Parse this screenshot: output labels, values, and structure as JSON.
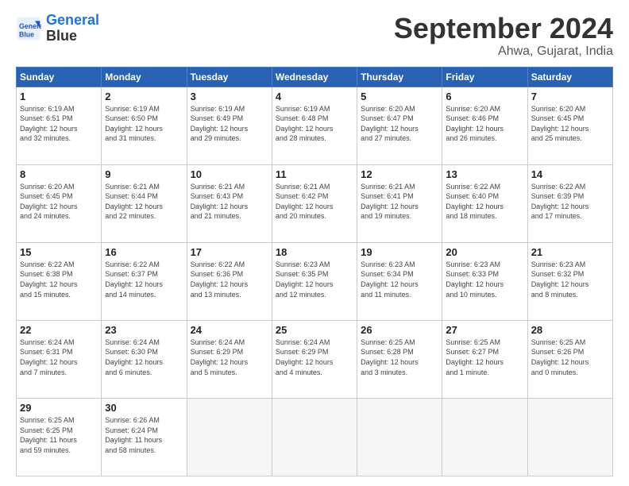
{
  "header": {
    "logo_line1": "General",
    "logo_line2": "Blue",
    "month": "September 2024",
    "location": "Ahwa, Gujarat, India"
  },
  "weekdays": [
    "Sunday",
    "Monday",
    "Tuesday",
    "Wednesday",
    "Thursday",
    "Friday",
    "Saturday"
  ],
  "weeks": [
    [
      {
        "day": "1",
        "info": "Sunrise: 6:19 AM\nSunset: 6:51 PM\nDaylight: 12 hours\nand 32 minutes."
      },
      {
        "day": "2",
        "info": "Sunrise: 6:19 AM\nSunset: 6:50 PM\nDaylight: 12 hours\nand 31 minutes."
      },
      {
        "day": "3",
        "info": "Sunrise: 6:19 AM\nSunset: 6:49 PM\nDaylight: 12 hours\nand 29 minutes."
      },
      {
        "day": "4",
        "info": "Sunrise: 6:19 AM\nSunset: 6:48 PM\nDaylight: 12 hours\nand 28 minutes."
      },
      {
        "day": "5",
        "info": "Sunrise: 6:20 AM\nSunset: 6:47 PM\nDaylight: 12 hours\nand 27 minutes."
      },
      {
        "day": "6",
        "info": "Sunrise: 6:20 AM\nSunset: 6:46 PM\nDaylight: 12 hours\nand 26 minutes."
      },
      {
        "day": "7",
        "info": "Sunrise: 6:20 AM\nSunset: 6:45 PM\nDaylight: 12 hours\nand 25 minutes."
      }
    ],
    [
      {
        "day": "8",
        "info": "Sunrise: 6:20 AM\nSunset: 6:45 PM\nDaylight: 12 hours\nand 24 minutes."
      },
      {
        "day": "9",
        "info": "Sunrise: 6:21 AM\nSunset: 6:44 PM\nDaylight: 12 hours\nand 22 minutes."
      },
      {
        "day": "10",
        "info": "Sunrise: 6:21 AM\nSunset: 6:43 PM\nDaylight: 12 hours\nand 21 minutes."
      },
      {
        "day": "11",
        "info": "Sunrise: 6:21 AM\nSunset: 6:42 PM\nDaylight: 12 hours\nand 20 minutes."
      },
      {
        "day": "12",
        "info": "Sunrise: 6:21 AM\nSunset: 6:41 PM\nDaylight: 12 hours\nand 19 minutes."
      },
      {
        "day": "13",
        "info": "Sunrise: 6:22 AM\nSunset: 6:40 PM\nDaylight: 12 hours\nand 18 minutes."
      },
      {
        "day": "14",
        "info": "Sunrise: 6:22 AM\nSunset: 6:39 PM\nDaylight: 12 hours\nand 17 minutes."
      }
    ],
    [
      {
        "day": "15",
        "info": "Sunrise: 6:22 AM\nSunset: 6:38 PM\nDaylight: 12 hours\nand 15 minutes."
      },
      {
        "day": "16",
        "info": "Sunrise: 6:22 AM\nSunset: 6:37 PM\nDaylight: 12 hours\nand 14 minutes."
      },
      {
        "day": "17",
        "info": "Sunrise: 6:22 AM\nSunset: 6:36 PM\nDaylight: 12 hours\nand 13 minutes."
      },
      {
        "day": "18",
        "info": "Sunrise: 6:23 AM\nSunset: 6:35 PM\nDaylight: 12 hours\nand 12 minutes."
      },
      {
        "day": "19",
        "info": "Sunrise: 6:23 AM\nSunset: 6:34 PM\nDaylight: 12 hours\nand 11 minutes."
      },
      {
        "day": "20",
        "info": "Sunrise: 6:23 AM\nSunset: 6:33 PM\nDaylight: 12 hours\nand 10 minutes."
      },
      {
        "day": "21",
        "info": "Sunrise: 6:23 AM\nSunset: 6:32 PM\nDaylight: 12 hours\nand 8 minutes."
      }
    ],
    [
      {
        "day": "22",
        "info": "Sunrise: 6:24 AM\nSunset: 6:31 PM\nDaylight: 12 hours\nand 7 minutes."
      },
      {
        "day": "23",
        "info": "Sunrise: 6:24 AM\nSunset: 6:30 PM\nDaylight: 12 hours\nand 6 minutes."
      },
      {
        "day": "24",
        "info": "Sunrise: 6:24 AM\nSunset: 6:29 PM\nDaylight: 12 hours\nand 5 minutes."
      },
      {
        "day": "25",
        "info": "Sunrise: 6:24 AM\nSunset: 6:29 PM\nDaylight: 12 hours\nand 4 minutes."
      },
      {
        "day": "26",
        "info": "Sunrise: 6:25 AM\nSunset: 6:28 PM\nDaylight: 12 hours\nand 3 minutes."
      },
      {
        "day": "27",
        "info": "Sunrise: 6:25 AM\nSunset: 6:27 PM\nDaylight: 12 hours\nand 1 minute."
      },
      {
        "day": "28",
        "info": "Sunrise: 6:25 AM\nSunset: 6:26 PM\nDaylight: 12 hours\nand 0 minutes."
      }
    ],
    [
      {
        "day": "29",
        "info": "Sunrise: 6:25 AM\nSunset: 6:25 PM\nDaylight: 11 hours\nand 59 minutes."
      },
      {
        "day": "30",
        "info": "Sunrise: 6:26 AM\nSunset: 6:24 PM\nDaylight: 11 hours\nand 58 minutes."
      },
      {
        "day": "",
        "info": ""
      },
      {
        "day": "",
        "info": ""
      },
      {
        "day": "",
        "info": ""
      },
      {
        "day": "",
        "info": ""
      },
      {
        "day": "",
        "info": ""
      }
    ]
  ]
}
